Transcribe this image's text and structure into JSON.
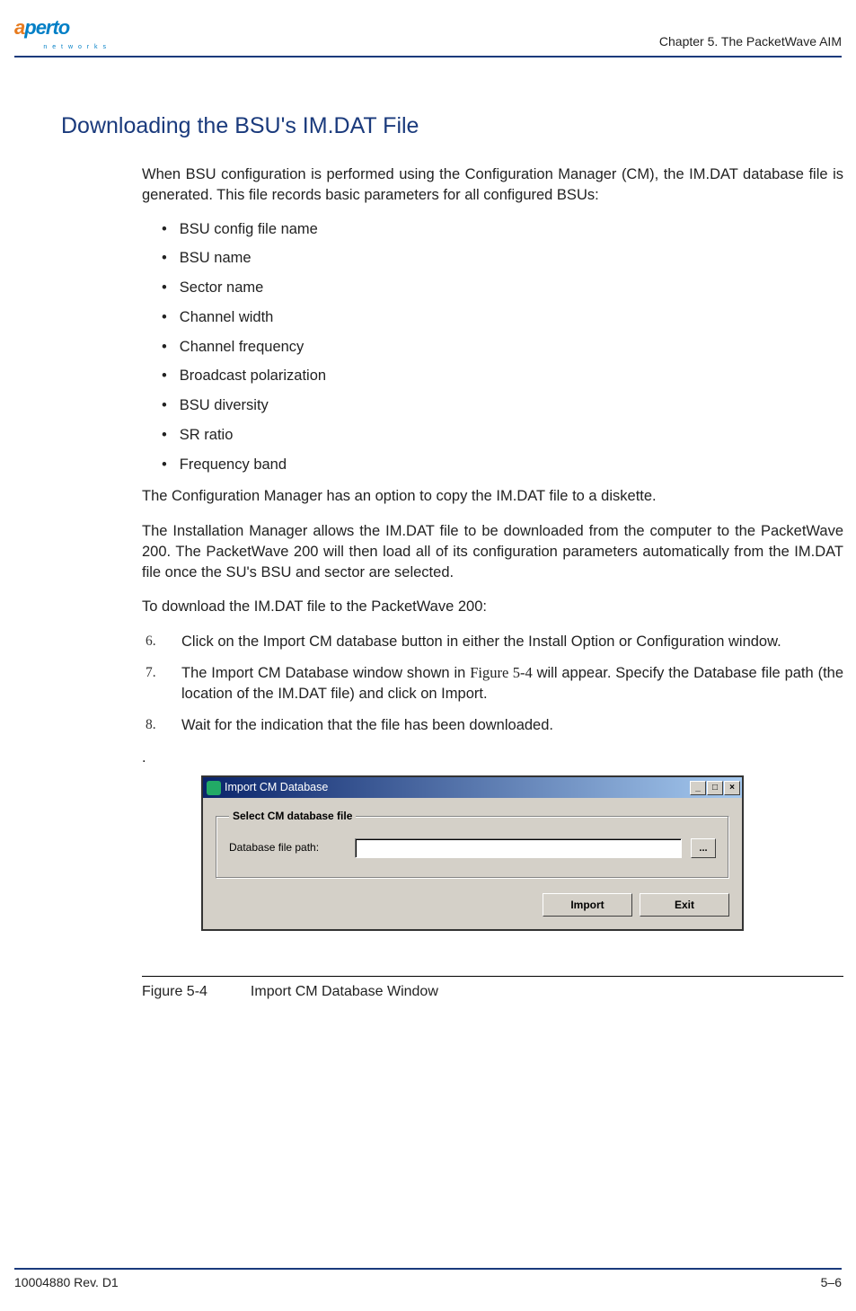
{
  "logo": {
    "brand_a": "a",
    "brand_b": "perto",
    "sub": "n e t w o r k s"
  },
  "header": {
    "chapter": "Chapter 5.  The PacketWave AIM"
  },
  "section": {
    "title": "Downloading the BSU's IM.DAT File",
    "intro": "When BSU configuration is performed using the Configuration Manager (CM), the IM.DAT database file is generated. This file records basic parameters for all configured BSUs:",
    "bullets": [
      "BSU config file name",
      "BSU name",
      "Sector name",
      "Channel width",
      "Channel frequency",
      "Broadcast polarization",
      "BSU diversity",
      "SR ratio",
      "Frequency band"
    ],
    "p_after_list": "The Configuration Manager has an option to copy the IM.DAT file to a diskette.",
    "p_install": "The Installation Manager allows the IM.DAT file to be downloaded from the computer to the PacketWave 200. The PacketWave 200 will then load all of its configuration parameters automatically from the IM.DAT file once the SU's BSU and sector are selected.",
    "p_todownload": "To download the IM.DAT file to the PacketWave 200:",
    "steps": [
      {
        "n": "6.",
        "t": "Click on the Import CM database button in either the Install Option or Configuration window."
      },
      {
        "n": "7.",
        "t_a": "The Import CM Database window shown in ",
        "t_figref": "Figure 5-4",
        "t_b": " will appear. Specify the Database file path (the location of the IM.DAT file) and click on Import."
      },
      {
        "n": "8.",
        "t": "Wait for the indication that the file has been downloaded."
      }
    ],
    "dot": "."
  },
  "dialog": {
    "title": "Import CM Database",
    "group_legend": "Select CM database file",
    "field_label": "Database file path:",
    "field_value": "",
    "browse_label": "...",
    "import_btn": "Import",
    "exit_btn": "Exit",
    "min_label": "_",
    "max_label": "□",
    "close_label": "×"
  },
  "figure": {
    "num": "Figure 5-4",
    "caption": "Import CM Database Window"
  },
  "footer": {
    "rev": "10004880 Rev. D1",
    "page": "5–6"
  }
}
